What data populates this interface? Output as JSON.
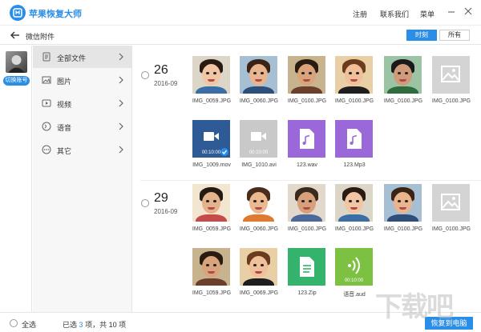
{
  "app": {
    "title": "苹果恢复大师"
  },
  "topmenu": {
    "register": "注册",
    "contact": "联系我们",
    "menu": "菜单"
  },
  "nav": {
    "breadcrumb": "微信附件",
    "seg_time": "时刻",
    "seg_all": "所有"
  },
  "account": {
    "switch_label": "切换账号"
  },
  "categories": [
    {
      "label": "全部文件",
      "icon": "file-icon",
      "active": true
    },
    {
      "label": "图片",
      "icon": "image-icon",
      "active": false
    },
    {
      "label": "视频",
      "icon": "video-icon",
      "active": false
    },
    {
      "label": "语音",
      "icon": "voice-icon",
      "active": false
    },
    {
      "label": "其它",
      "icon": "more-icon",
      "active": false
    }
  ],
  "groups": [
    {
      "day": "26",
      "month": "2016-09",
      "items": [
        {
          "name": "IMG_0059.JPG",
          "kind": "photo"
        },
        {
          "name": "IMG_0060.JPG",
          "kind": "photo"
        },
        {
          "name": "IMG_0100.JPG",
          "kind": "photo"
        },
        {
          "name": "IMG_0100.JPG",
          "kind": "photo"
        },
        {
          "name": "IMG_0100.JPG",
          "kind": "photo"
        },
        {
          "name": "IMG_0100.JPG",
          "kind": "placeholder"
        },
        {
          "name": "IMG_1009.mov",
          "kind": "video",
          "duration": "00:10:00",
          "checked": true
        },
        {
          "name": "IMG_1010.avi",
          "kind": "video-gray",
          "duration": "00:10:00"
        },
        {
          "name": "123.wav",
          "kind": "audio"
        },
        {
          "name": "123.Mp3",
          "kind": "audio"
        }
      ]
    },
    {
      "day": "29",
      "month": "2016-09",
      "items": [
        {
          "name": "IMG_0059.JPG",
          "kind": "photo"
        },
        {
          "name": "IMG_0060.JPG",
          "kind": "photo"
        },
        {
          "name": "IMG_0100.JPG",
          "kind": "photo"
        },
        {
          "name": "IMG_0100.JPG",
          "kind": "photo"
        },
        {
          "name": "IMG_0100.JPG",
          "kind": "photo"
        },
        {
          "name": "IMG_0100.JPG",
          "kind": "placeholder"
        },
        {
          "name": "IMG_1059.JPG",
          "kind": "photo"
        },
        {
          "name": "IMG_0069.JPG",
          "kind": "photo"
        },
        {
          "name": "123.Zip",
          "kind": "zip"
        },
        {
          "name": "语音.aud",
          "kind": "voice",
          "duration": "00:10:00"
        }
      ]
    }
  ],
  "footer": {
    "select_all": "全选",
    "selected_prefix": "已选",
    "selected_count": "3",
    "selected_suffix": "项，共 10 项",
    "recover_button": "恢复到电脑"
  },
  "watermark": "下载吧",
  "colors": {
    "accent": "#2b8ee6",
    "audio": "#9a68d8",
    "zip": "#33b36b",
    "voice": "#7cc142",
    "video": "#2e5a95",
    "placeholder": "#d4d4d4"
  }
}
